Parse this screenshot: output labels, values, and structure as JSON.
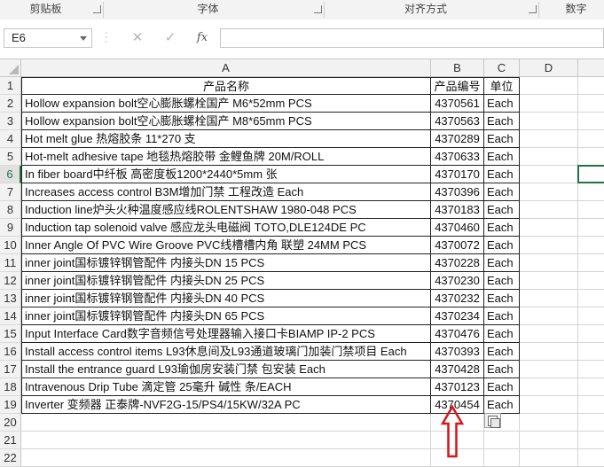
{
  "ribbon": {
    "groups": [
      {
        "label": "剪贴板"
      },
      {
        "label": "字体"
      },
      {
        "label": "对齐方式"
      },
      {
        "label": "数字"
      }
    ]
  },
  "formula_bar": {
    "name_box": "E6",
    "cancel_icon": "✕",
    "enter_icon": "✓",
    "fx_label": "fx",
    "formula_value": ""
  },
  "columns": [
    {
      "label": ""
    },
    {
      "label": "A"
    },
    {
      "label": "B"
    },
    {
      "label": "C"
    },
    {
      "label": "D"
    },
    {
      "label": ""
    }
  ],
  "rows": [
    {
      "num": "1",
      "a": "产品名称",
      "b": "产品编号",
      "c": "单位"
    },
    {
      "num": "2",
      "a": "Hollow expansion bolt空心膨胀螺栓国产 M6*52mm PCS",
      "b": "4370561",
      "c": "Each"
    },
    {
      "num": "3",
      "a": "Hollow expansion bolt空心膨胀螺栓国产 M8*65mm PCS",
      "b": "4370563",
      "c": "Each"
    },
    {
      "num": "4",
      "a": "Hot melt glue 热熔胶条 11*270  支",
      "b": "4370289",
      "c": "Each"
    },
    {
      "num": "5",
      "a": "Hot-melt adhesive tape 地毯热熔胶带 金鲤鱼牌 20M/ROLL",
      "b": "4370633",
      "c": "Each"
    },
    {
      "num": "6",
      "a": "In fiber board中纤板 高密度板1200*2440*5mm 张",
      "b": "4370170",
      "c": "Each"
    },
    {
      "num": "7",
      "a": "Increases access control B3M增加门禁 工程改造 Each",
      "b": "4370396",
      "c": "Each"
    },
    {
      "num": "8",
      "a": "Induction line炉头火种温度感应线ROLENTSHAW 1980-048 PCS",
      "b": "4370183",
      "c": "Each"
    },
    {
      "num": "9",
      "a": "Induction tap solenoid valve 感应龙头电磁阀 TOTO,DLE124DE PC",
      "b": "4370460",
      "c": "Each"
    },
    {
      "num": "10",
      "a": "Inner Angle Of PVC Wire Groove PVC线槽槽内角 联塑 24MM PCS",
      "b": "4370072",
      "c": "Each"
    },
    {
      "num": "11",
      "a": "inner joint国标镀锌钢管配件  内接头DN 15  PCS",
      "b": "4370228",
      "c": "Each"
    },
    {
      "num": "12",
      "a": "inner joint国标镀锌钢管配件  内接头DN 25  PCS",
      "b": "4370230",
      "c": "Each"
    },
    {
      "num": "13",
      "a": "inner joint国标镀锌钢管配件  内接头DN 40  PCS",
      "b": "4370232",
      "c": "Each"
    },
    {
      "num": "14",
      "a": "inner joint国标镀锌钢管配件  内接头DN 65  PCS",
      "b": "4370234",
      "c": "Each"
    },
    {
      "num": "15",
      "a": "Input Interface Card数字音频信号处理器输入接口卡BIAMP IP-2 PCS",
      "b": "4370476",
      "c": "Each"
    },
    {
      "num": "16",
      "a": "Install access control items L93休息间及L93通道玻璃门加装门禁项目 Each",
      "b": "4370393",
      "c": "Each"
    },
    {
      "num": "17",
      "a": "Install the entrance guard L93瑜伽房安装门禁 包安装 Each",
      "b": "4370428",
      "c": "Each"
    },
    {
      "num": "18",
      "a": "Intravenous Drip Tube 滴定管 25毫升 碱性 条/EACH",
      "b": "4370123",
      "c": "Each"
    },
    {
      "num": "19",
      "a": "Inverter 变频器 正泰牌-NVF2G-15/PS4/15KW/32A PC",
      "b": "4370454",
      "c": "Each"
    },
    {
      "num": "20",
      "a": "",
      "b": "",
      "c": ""
    },
    {
      "num": "21",
      "a": "",
      "b": "",
      "c": ""
    },
    {
      "num": "22",
      "a": "",
      "b": "",
      "c": ""
    }
  ],
  "colors": {
    "accent": "#217346",
    "arrow": "#d9141b"
  }
}
